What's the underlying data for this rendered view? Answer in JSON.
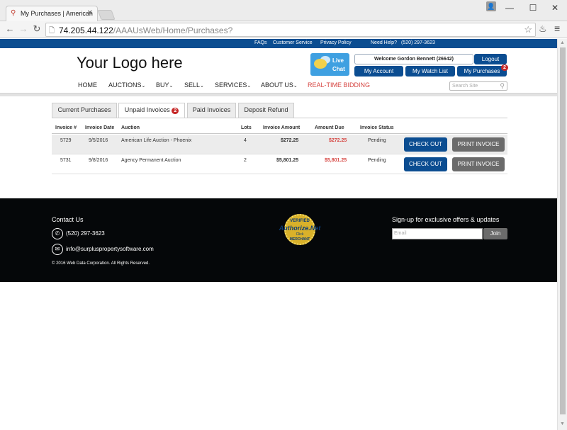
{
  "browser": {
    "tab_title": "My Purchases | American",
    "tab_favicon": "pin-icon",
    "url_host": "74.205.44.122",
    "url_path": "/AAAUsWeb/Home/Purchases?",
    "window_controls": [
      "minimize",
      "maximize",
      "close"
    ]
  },
  "top_links": {
    "faqs": "FAQs",
    "customer_service": "Customer Service",
    "privacy": "Privacy Policy",
    "help": "Need Help?",
    "help_phone": "(520) 297-3623"
  },
  "header": {
    "logo": "Your Logo here",
    "live_chat_line1": "Live",
    "live_chat_line2": "Chat",
    "welcome": "Welcome Gordon Bennett (26642)",
    "logout": "Logout",
    "my_account": "My Account",
    "my_watch_list": "My Watch List",
    "my_purchases": "My Purchases",
    "purchases_badge": "2"
  },
  "nav": {
    "home": "HOME",
    "auctions": "AUCTIONS",
    "buy": "BUY",
    "sell": "SELL",
    "services": "SERVICES",
    "about": "ABOUT US",
    "realtime": "REAL-TIME BIDDING",
    "search_placeholder": "Search Site",
    "caret": "⌄"
  },
  "tabs": {
    "current": "Current Purchases",
    "unpaid": "Unpaid Invoices",
    "unpaid_badge": "2",
    "paid": "Paid Invoices",
    "deposit": "Deposit Refund"
  },
  "table": {
    "headers": {
      "invoice": "Invoice #",
      "date": "Invoice Date",
      "auction": "Auction",
      "lots": "Lots",
      "amount": "Invoice Amount",
      "due": "Amount Due",
      "status": "Invoice Status"
    },
    "rows": [
      {
        "invoice": "5729",
        "date": "9/5/2016",
        "auction": "American Life Auction - Phoenix",
        "lots": "4",
        "amount": "$272.25",
        "due": "$272.25",
        "status": "Pending",
        "checkout": "CHECK OUT",
        "print": "PRINT INVOICE"
      },
      {
        "invoice": "5731",
        "date": "9/8/2016",
        "auction": "Agency Permanent Auction",
        "lots": "2",
        "amount": "$5,801.25",
        "due": "$5,801.25",
        "status": "Pending",
        "checkout": "CHECK OUT",
        "print": "PRINT INVOICE"
      }
    ]
  },
  "footer": {
    "contact_title": "Contact Us",
    "phone": "(520) 297-3623",
    "email": "info@surpluspropertysoftware.com",
    "copyright": "© 2016 Web Data Corporation. All Rights Reserved.",
    "seal_top": "VERIFIED",
    "seal_brand": "Authorize.Net",
    "seal_click": "Click",
    "seal_bottom": "MERCHANT",
    "signup_title": "Sign-up for exclusive offers & updates",
    "email_placeholder": "Email",
    "join": "Join"
  },
  "colors": {
    "brand_blue": "#0b4d91",
    "alert_red": "#d64541",
    "footer_bg": "#050709",
    "button_gray": "#6b6b6b"
  }
}
